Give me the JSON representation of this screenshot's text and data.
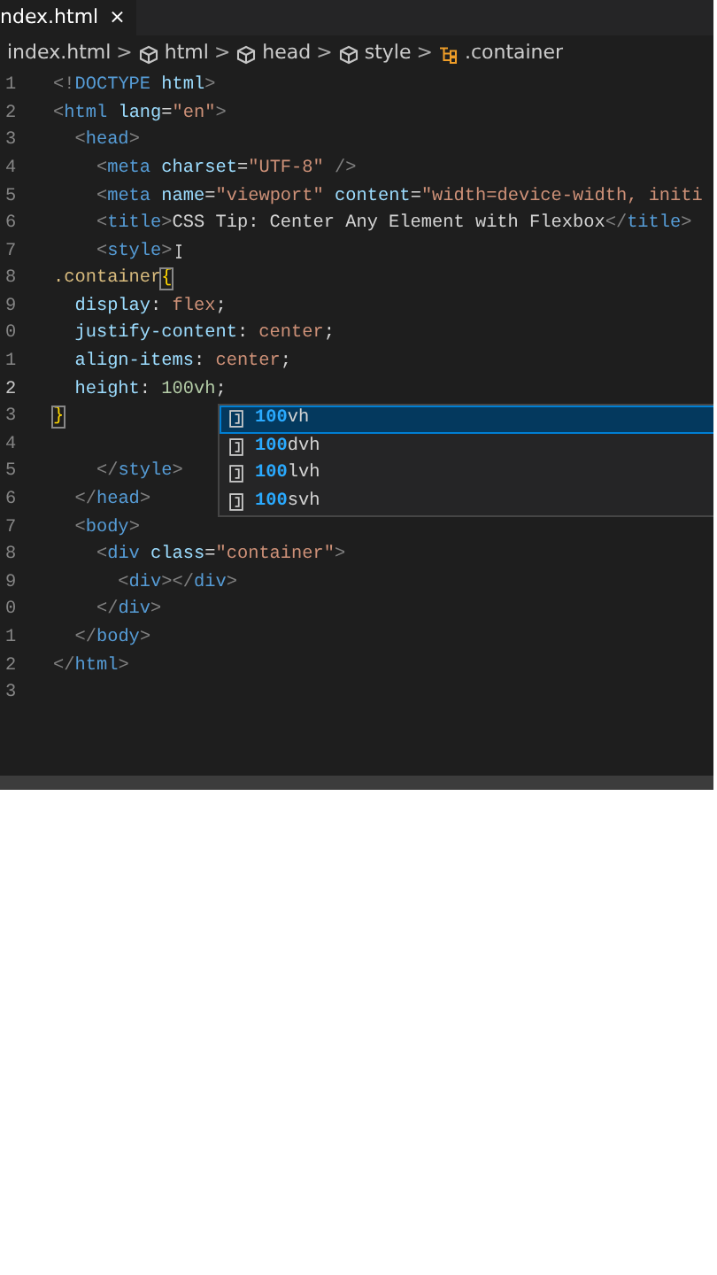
{
  "tab": {
    "label": "ndex.html",
    "close": "×",
    "selected": true
  },
  "breadcrumb": [
    {
      "label": "index.html",
      "kind": "file"
    },
    {
      "label": "html",
      "kind": "element"
    },
    {
      "label": "head",
      "kind": "element"
    },
    {
      "label": "style",
      "kind": "element"
    },
    {
      "label": ".container",
      "kind": "selector"
    }
  ],
  "breadcrumb_separator": ">",
  "code": [
    {
      "number": "1",
      "current": false,
      "cursor": false,
      "tokens": [
        {
          "kind": "punct",
          "text": "<!"
        },
        {
          "kind": "tag",
          "text": "DOCTYPE"
        },
        {
          "kind": "attr",
          "text": " html"
        },
        {
          "kind": "punct",
          "text": ">"
        }
      ]
    },
    {
      "number": "2",
      "current": false,
      "cursor": false,
      "tokens": [
        {
          "kind": "punct",
          "text": "<"
        },
        {
          "kind": "tag",
          "text": "html"
        },
        {
          "kind": "attr",
          "text": " lang"
        },
        {
          "kind": "plain",
          "text": "="
        },
        {
          "kind": "string",
          "text": "\"en\""
        },
        {
          "kind": "punct",
          "text": ">"
        }
      ]
    },
    {
      "number": "3",
      "current": false,
      "cursor": false,
      "tokens": [
        {
          "kind": "punct",
          "text": "  <"
        },
        {
          "kind": "tag",
          "text": "head"
        },
        {
          "kind": "punct",
          "text": ">"
        }
      ]
    },
    {
      "number": "4",
      "current": false,
      "cursor": false,
      "tokens": [
        {
          "kind": "punct",
          "text": "    <"
        },
        {
          "kind": "tag",
          "text": "meta"
        },
        {
          "kind": "attr",
          "text": " charset"
        },
        {
          "kind": "plain",
          "text": "="
        },
        {
          "kind": "string",
          "text": "\"UTF-8\""
        },
        {
          "kind": "punct",
          "text": " />"
        }
      ]
    },
    {
      "number": "5",
      "current": false,
      "cursor": false,
      "tokens": [
        {
          "kind": "punct",
          "text": "    <"
        },
        {
          "kind": "tag",
          "text": "meta"
        },
        {
          "kind": "attr",
          "text": " name"
        },
        {
          "kind": "plain",
          "text": "="
        },
        {
          "kind": "string",
          "text": "\"viewport\""
        },
        {
          "kind": "attr",
          "text": " content"
        },
        {
          "kind": "plain",
          "text": "="
        },
        {
          "kind": "string",
          "text": "\"width=device-width, initi"
        }
      ]
    },
    {
      "number": "6",
      "current": false,
      "cursor": false,
      "tokens": [
        {
          "kind": "punct",
          "text": "    <"
        },
        {
          "kind": "tag",
          "text": "title"
        },
        {
          "kind": "punct",
          "text": ">"
        },
        {
          "kind": "plain",
          "text": "CSS Tip: Center Any Element with Flexbox"
        },
        {
          "kind": "punct",
          "text": "</"
        },
        {
          "kind": "tag",
          "text": "title"
        },
        {
          "kind": "punct",
          "text": ">"
        }
      ]
    },
    {
      "number": "7",
      "current": false,
      "cursor": true,
      "tokens": [
        {
          "kind": "punct",
          "text": "    <"
        },
        {
          "kind": "tag",
          "text": "style"
        },
        {
          "kind": "punct",
          "text": ">"
        }
      ]
    },
    {
      "number": "8",
      "current": false,
      "cursor": false,
      "tokens": [
        {
          "kind": "selector",
          "text": ".container"
        },
        {
          "kind": "bracket",
          "text": "{"
        }
      ]
    },
    {
      "number": "9",
      "current": false,
      "cursor": false,
      "tokens": [
        {
          "kind": "property",
          "text": "  display"
        },
        {
          "kind": "plain",
          "text": ": "
        },
        {
          "kind": "value",
          "text": "flex"
        },
        {
          "kind": "plain",
          "text": ";"
        }
      ]
    },
    {
      "number": "0",
      "current": false,
      "cursor": false,
      "tokens": [
        {
          "kind": "property",
          "text": "  justify-content"
        },
        {
          "kind": "plain",
          "text": ": "
        },
        {
          "kind": "value",
          "text": "center"
        },
        {
          "kind": "plain",
          "text": ";"
        }
      ]
    },
    {
      "number": "1",
      "current": false,
      "cursor": false,
      "tokens": [
        {
          "kind": "property",
          "text": "  align-items"
        },
        {
          "kind": "plain",
          "text": ": "
        },
        {
          "kind": "value",
          "text": "center"
        },
        {
          "kind": "plain",
          "text": ";"
        }
      ]
    },
    {
      "number": "2",
      "current": true,
      "cursor": false,
      "tokens": [
        {
          "kind": "property",
          "text": "  height"
        },
        {
          "kind": "plain",
          "text": ": "
        },
        {
          "kind": "number",
          "text": "100vh"
        },
        {
          "kind": "plain",
          "text": ";"
        }
      ]
    },
    {
      "number": "3",
      "current": false,
      "cursor": false,
      "tokens": [
        {
          "kind": "bracket",
          "text": "}"
        }
      ]
    },
    {
      "number": "4",
      "current": false,
      "cursor": false
    },
    {
      "number": "5",
      "current": false,
      "cursor": false,
      "tokens": [
        {
          "kind": "punct",
          "text": "    </"
        },
        {
          "kind": "tag",
          "text": "style"
        },
        {
          "kind": "punct",
          "text": ">"
        }
      ]
    },
    {
      "number": "6",
      "current": false,
      "cursor": false,
      "tokens": [
        {
          "kind": "punct",
          "text": "  </"
        },
        {
          "kind": "tag",
          "text": "head"
        },
        {
          "kind": "punct",
          "text": ">"
        }
      ]
    },
    {
      "number": "7",
      "current": false,
      "cursor": false,
      "tokens": [
        {
          "kind": "punct",
          "text": "  <"
        },
        {
          "kind": "tag",
          "text": "body"
        },
        {
          "kind": "punct",
          "text": ">"
        }
      ]
    },
    {
      "number": "8",
      "current": false,
      "cursor": false,
      "tokens": [
        {
          "kind": "punct",
          "text": "    <"
        },
        {
          "kind": "tag",
          "text": "div"
        },
        {
          "kind": "attr",
          "text": " class"
        },
        {
          "kind": "plain",
          "text": "="
        },
        {
          "kind": "string",
          "text": "\"container\""
        },
        {
          "kind": "punct",
          "text": ">"
        }
      ]
    },
    {
      "number": "9",
      "current": false,
      "cursor": false,
      "tokens": [
        {
          "kind": "punct",
          "text": "      <"
        },
        {
          "kind": "tag",
          "text": "div"
        },
        {
          "kind": "punct",
          "text": "></"
        },
        {
          "kind": "tag",
          "text": "div"
        },
        {
          "kind": "punct",
          "text": ">"
        }
      ]
    },
    {
      "number": "0",
      "current": false,
      "cursor": false,
      "tokens": [
        {
          "kind": "punct",
          "text": "    </"
        },
        {
          "kind": "tag",
          "text": "div"
        },
        {
          "kind": "punct",
          "text": ">"
        }
      ]
    },
    {
      "number": "1",
      "current": false,
      "cursor": false,
      "tokens": [
        {
          "kind": "punct",
          "text": "  </"
        },
        {
          "kind": "tag",
          "text": "body"
        },
        {
          "kind": "punct",
          "text": ">"
        }
      ]
    },
    {
      "number": "2",
      "current": false,
      "cursor": false,
      "tokens": [
        {
          "kind": "punct",
          "text": "</"
        },
        {
          "kind": "tag",
          "text": "html"
        },
        {
          "kind": "punct",
          "text": ">"
        }
      ]
    },
    {
      "number": "3",
      "current": false,
      "cursor": false
    }
  ],
  "suggestions": [
    {
      "match": "100",
      "rest": "vh",
      "selected": true
    },
    {
      "match": "100",
      "rest": "dvh",
      "selected": false
    },
    {
      "match": "100",
      "rest": "lvh",
      "selected": false
    },
    {
      "match": "100",
      "rest": "svh",
      "selected": false
    }
  ]
}
